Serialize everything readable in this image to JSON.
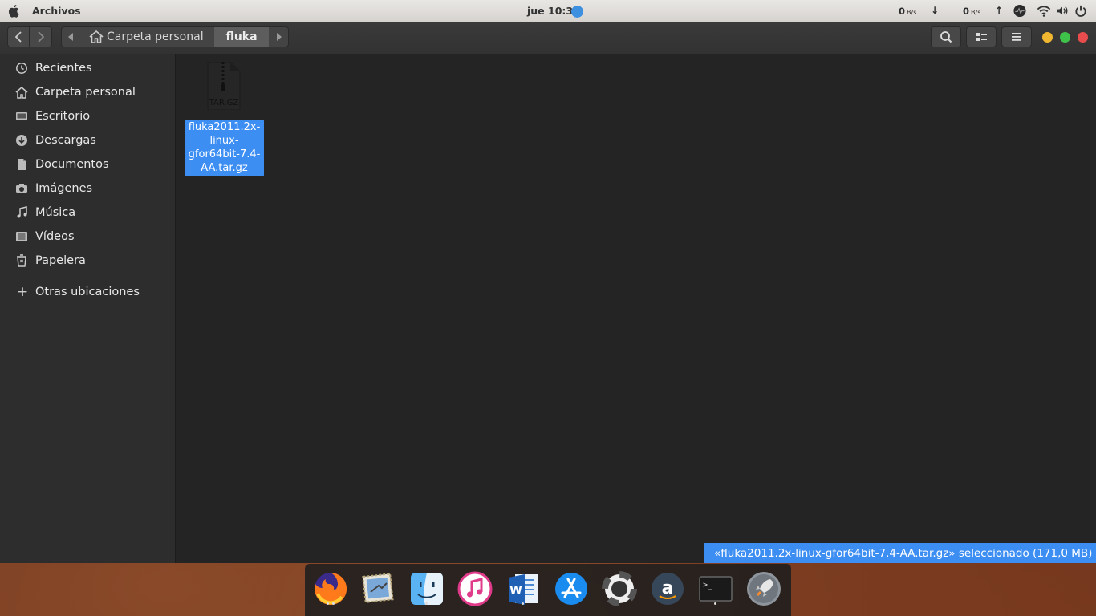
{
  "topbar": {
    "app_name": "Archivos",
    "clock": "jue 10:38",
    "net_down_value": "0",
    "net_down_unit": "B/s",
    "net_up_value": "0",
    "net_up_unit": "B/s",
    "down_arrow": "↓",
    "up_arrow": "↑"
  },
  "header": {
    "home_crumb": "Carpeta personal",
    "current_crumb": "fluka"
  },
  "sidebar": {
    "items": [
      {
        "label": "Recientes",
        "icon": "clock-icon"
      },
      {
        "label": "Carpeta personal",
        "icon": "home-icon"
      },
      {
        "label": "Escritorio",
        "icon": "desktop-icon"
      },
      {
        "label": "Descargas",
        "icon": "download-icon"
      },
      {
        "label": "Documentos",
        "icon": "document-icon"
      },
      {
        "label": "Imágenes",
        "icon": "camera-icon"
      },
      {
        "label": "Música",
        "icon": "music-icon"
      },
      {
        "label": "Vídeos",
        "icon": "video-icon"
      },
      {
        "label": "Papelera",
        "icon": "trash-icon"
      }
    ],
    "other_locations": "Otras ubicaciones",
    "plus": "+"
  },
  "content": {
    "file": {
      "type_badge": "TAR.GZ",
      "name_line1": "fluka2011.2x-",
      "name_line2": "linux-",
      "name_line3": "gfor64bit-7.4-",
      "name_line4": "AA.tar.gz"
    }
  },
  "status": {
    "text": "«fluka2011.2x-linux-gfor64bit-7.4-AA.tar.gz» seleccionado  (171,0 MB)"
  },
  "dock": {
    "items": [
      "firefox-icon",
      "mail-icon",
      "finder-icon",
      "itunes-icon",
      "word-icon",
      "app-store-icon",
      "help-lifebuoy-icon",
      "amazon-icon",
      "terminal-icon",
      "launchpad-rocket-icon"
    ],
    "amazon_glyph": "a",
    "terminal_prompt": ">_"
  },
  "colors": {
    "accent": "#3d8ef2",
    "close": "#e84c4c",
    "maximize": "#3fc24a",
    "minimize": "#f2b730"
  }
}
